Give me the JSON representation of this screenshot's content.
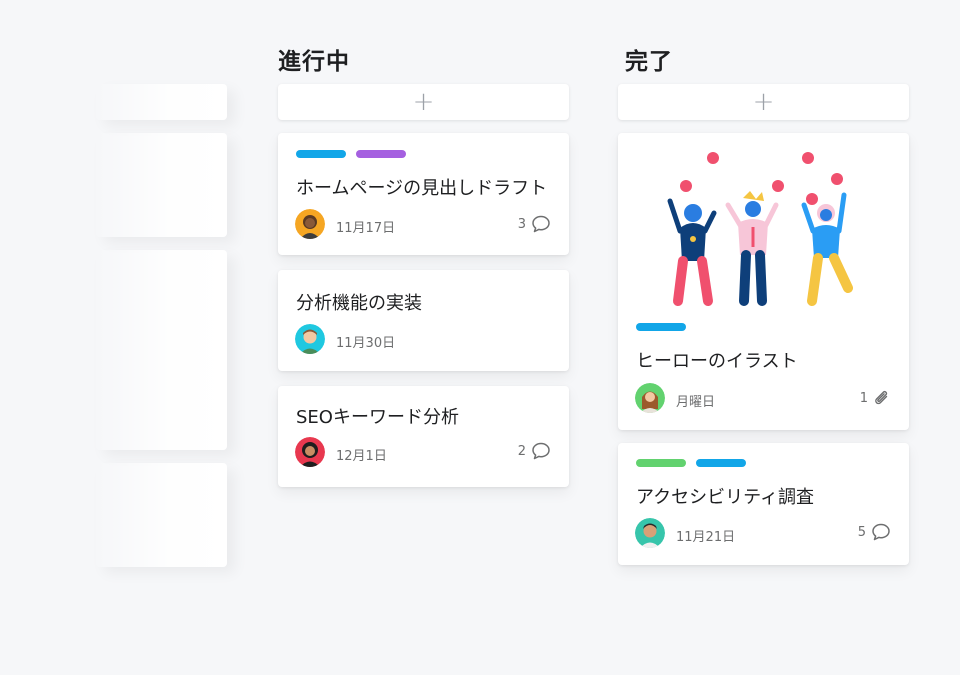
{
  "columns": [
    {
      "title": "進行中",
      "add_label": "+",
      "cards": [
        {
          "tags": [
            "#12a6e8",
            "#a560e0"
          ],
          "title": "ホームページの見出しドラフト",
          "date": "11月17日",
          "count": "3",
          "meta_icon": "comment-icon",
          "avatar_color": "#f5a623"
        },
        {
          "tags": [],
          "title": "分析機能の実装",
          "date": "11月30日",
          "count": "",
          "meta_icon": "",
          "avatar_color": "#1fc8e0"
        },
        {
          "tags": [],
          "title": "SEOキーワード分析",
          "date": "12月1日",
          "count": "2",
          "meta_icon": "comment-icon",
          "avatar_color": "#e8384f"
        }
      ]
    },
    {
      "title": "完了",
      "add_label": "+",
      "cards": [
        {
          "tags": [
            "#12a6e8"
          ],
          "title": "ヒーローのイラスト",
          "date": "月曜日",
          "count": "1",
          "meta_icon": "paperclip-icon",
          "avatar_color": "#62d26f",
          "illustration": "juggling-people-illustration"
        },
        {
          "tags": [
            "#62d26f",
            "#12a6e8"
          ],
          "title": "アクセシビリティ調査",
          "date": "11月21日",
          "count": "5",
          "meta_icon": "comment-icon",
          "avatar_color": "#37c5ab"
        }
      ]
    }
  ],
  "colors": {
    "background": "#f6f7f9",
    "card": "#ffffff",
    "blue_tag": "#12a6e8",
    "purple_tag": "#a560e0",
    "green_tag": "#62d26f",
    "juggling_ball": "#f0506e"
  }
}
